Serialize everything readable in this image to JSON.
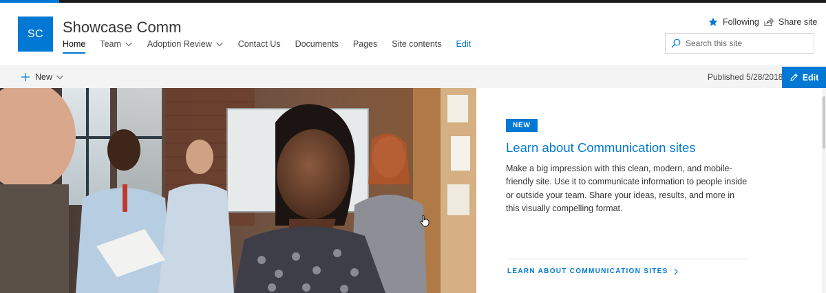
{
  "site": {
    "logo_initials": "SC",
    "title": "Showcase Comm"
  },
  "nav": {
    "items": [
      {
        "label": "Home",
        "active": true
      },
      {
        "label": "Team",
        "dropdown": true
      },
      {
        "label": "Adoption Review",
        "dropdown": true
      },
      {
        "label": "Contact Us"
      },
      {
        "label": "Documents"
      },
      {
        "label": "Pages"
      },
      {
        "label": "Site contents"
      },
      {
        "label": "Edit"
      }
    ]
  },
  "actions": {
    "following_label": "Following",
    "share_label": "Share site"
  },
  "search": {
    "placeholder": "Search this site"
  },
  "commandbar": {
    "new_label": "New",
    "published_text": "Published 5/28/2018",
    "edit_label": "Edit"
  },
  "hero": {
    "badge": "NEW",
    "title": "Learn about Communication sites",
    "description": "Make a big impression with this clean, modern, and mobile-friendly site. Use it to communicate information to people inside or outside your team. Share your ideas, results, and more in this visually compelling format.",
    "link_label": "LEARN ABOUT COMMUNICATION SITES"
  },
  "colors": {
    "accent": "#0078d4",
    "commandbar_bg": "#f4f4f4",
    "topbar": "#1b1b1b"
  }
}
